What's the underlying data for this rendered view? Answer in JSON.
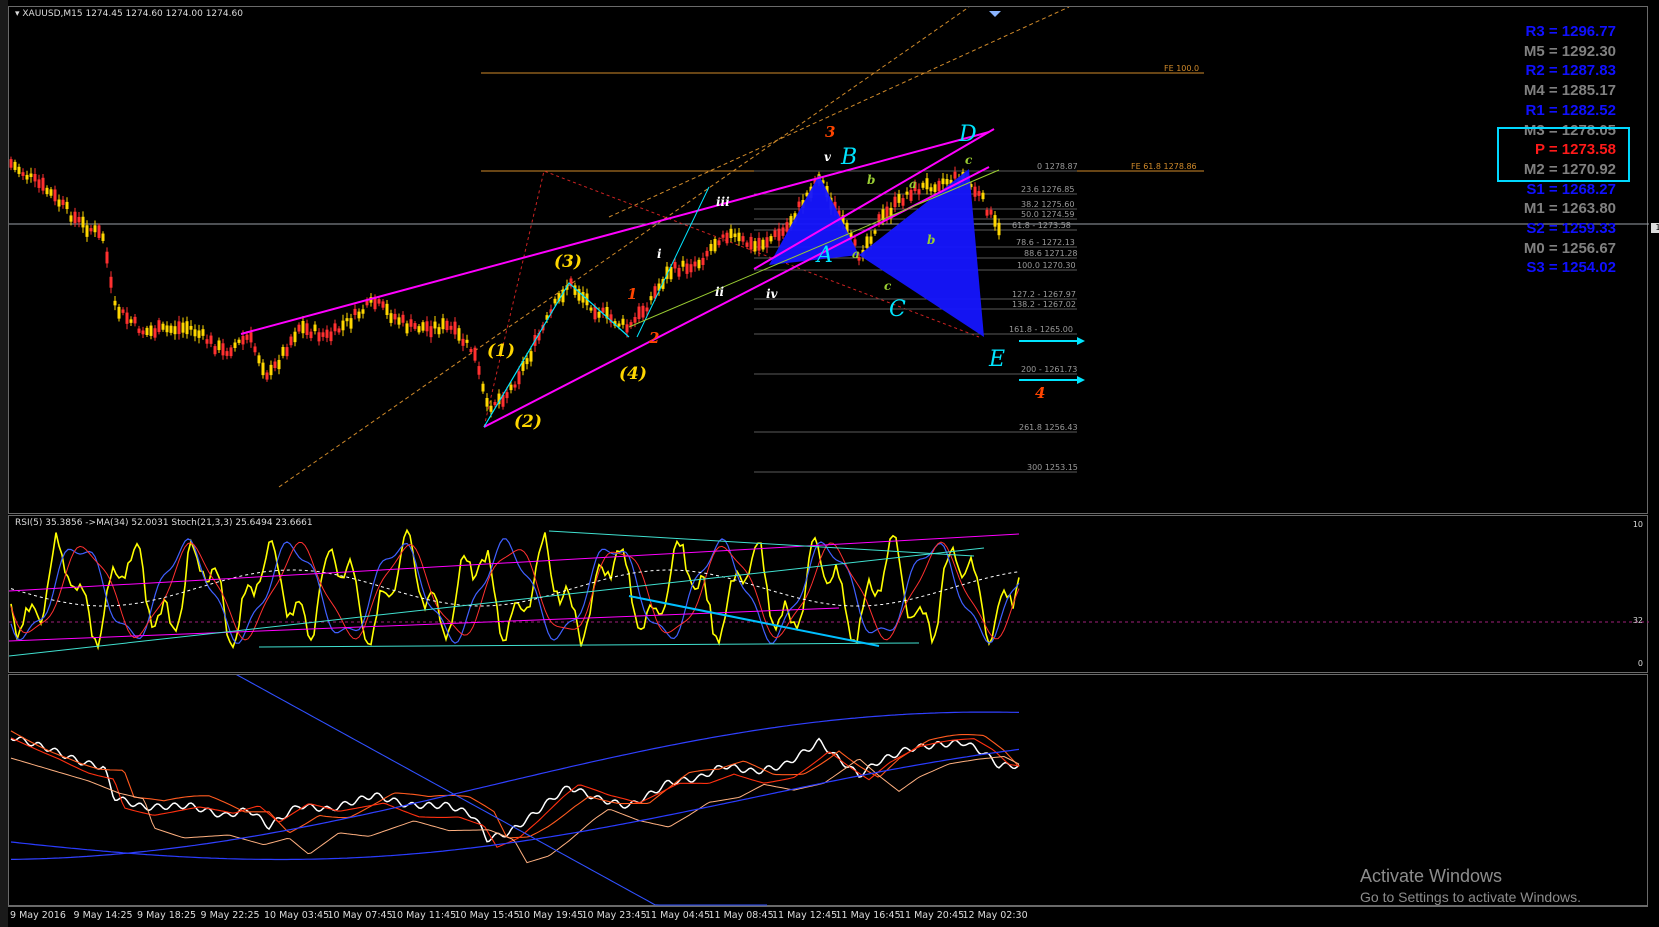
{
  "chart": {
    "symbol_header": "XAUUSD,M15  1274.45 1274.60 1274.00 1274.60",
    "osc_header": "RSI(5) 35.3856  ->MA(34) 52.0031  Stoch(21,3,3) 25.6494 23.6661",
    "price_flag": "1",
    "osc_axis": {
      "top": "10",
      "mid": "32",
      "bottom": "0"
    }
  },
  "pivots": [
    {
      "label": "R3 = 1296.77",
      "color": "#1010ff"
    },
    {
      "label": "M5 = 1292.30",
      "color": "#808080"
    },
    {
      "label": "R2 = 1287.83",
      "color": "#1010ff"
    },
    {
      "label": "M4 = 1285.17",
      "color": "#808080"
    },
    {
      "label": "R1 = 1282.52",
      "color": "#1010ff"
    },
    {
      "label": "M3 = 1278.05",
      "color": "#808080"
    },
    {
      "label": "P  = 1273.58",
      "color": "#ff1a1a"
    },
    {
      "label": "M2 = 1270.92",
      "color": "#808080"
    },
    {
      "label": "S1 = 1268.27",
      "color": "#1010ff"
    },
    {
      "label": "M1 = 1263.80",
      "color": "#808080"
    },
    {
      "label": "S2 = 1259.33",
      "color": "#1010ff"
    },
    {
      "label": "M0 = 1256.67",
      "color": "#808080"
    },
    {
      "label": "S3 = 1254.02",
      "color": "#1010ff"
    }
  ],
  "fib_labels": {
    "fe100": "FE 100.0",
    "fe618": "FE 61.8 1278.86",
    "zero": "0 1278.87",
    "f236": "23.6 1276.85",
    "f382": "38.2 1275.60",
    "f500": "50.0 1274.59",
    "f618": "61.8 - 1273.58",
    "f786": "78.6 - 1272.13",
    "f886": "88.6 1271.28",
    "f1000": "100.0 1270.30",
    "f1272": "127.2 - 1267.97",
    "f1382": "138.2 - 1267.02",
    "f1618": "161.8 - 1265.00",
    "f200": "200 - 1261.73",
    "f2618": "261.8 1256.43",
    "f300": "300 1253.15"
  },
  "wave_labels": {
    "w1": "(1)",
    "w2": "(2)",
    "w3": "(3)",
    "w4": "(4)",
    "i": "i",
    "ii": "ii",
    "iii": "iii",
    "iv": "iv",
    "v": "v",
    "r1": "1",
    "r2": "2",
    "r3": "3",
    "r4": "4",
    "A": "A",
    "B": "B",
    "C": "C",
    "D": "D",
    "E": "E",
    "a1": "a",
    "b1": "b",
    "c1": "c",
    "a2": "a",
    "b2": "b",
    "c2": "c"
  },
  "time_axis": [
    "9 May 2016",
    "9 May 14:25",
    "9 May 18:25",
    "9 May 22:25",
    "10 May 03:45",
    "10 May 07:45",
    "10 May 11:45",
    "10 May 15:45",
    "10 May 19:45",
    "10 May 23:45",
    "11 May 04:45",
    "11 May 08:45",
    "11 May 12:45",
    "11 May 16:45",
    "11 May 20:45",
    "12 May 02:30"
  ],
  "watermark": {
    "line1": "Activate Windows",
    "line2": "Go to Settings to activate Windows."
  },
  "colors": {
    "candle": "#ffd700",
    "trend": "#ff00ff",
    "accent": "#00e5ff",
    "fib_line": "#d08a2a",
    "pattern": "#1515ff"
  }
}
